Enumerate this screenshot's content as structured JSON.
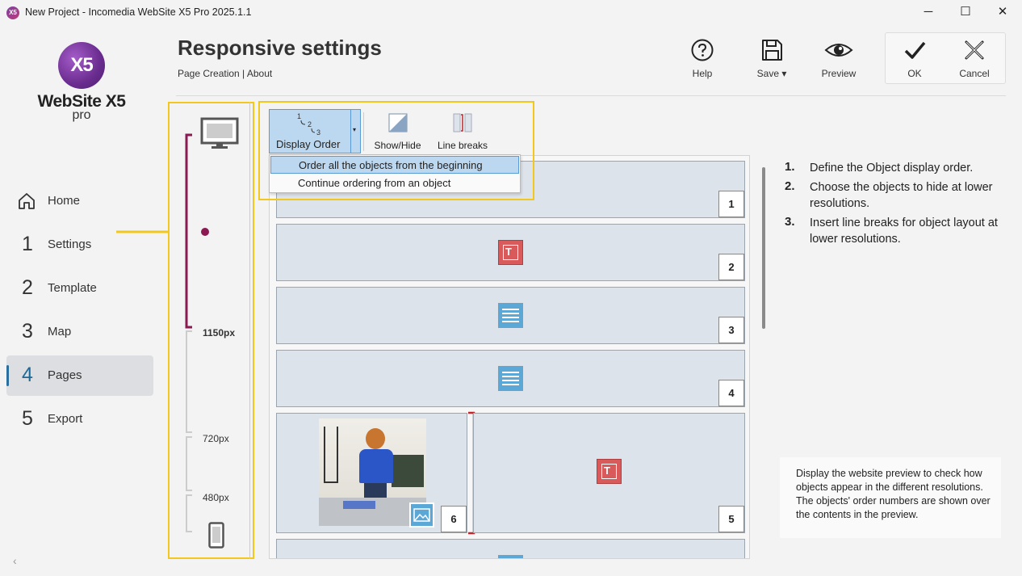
{
  "window": {
    "title": "New Project - Incomedia WebSite X5 Pro 2025.1.1",
    "app_icon": "X5",
    "minimize": "─",
    "maximize": "☐",
    "close": "✕"
  },
  "logo": {
    "mark": "X5",
    "name": "WebSite X5",
    "edition": "pro"
  },
  "nav": [
    {
      "num": "",
      "label": "Home",
      "icon": "home-icon"
    },
    {
      "num": "1",
      "label": "Settings"
    },
    {
      "num": "2",
      "label": "Template"
    },
    {
      "num": "3",
      "label": "Map"
    },
    {
      "num": "4",
      "label": "Pages"
    },
    {
      "num": "5",
      "label": "Export"
    }
  ],
  "header": {
    "title": "Responsive settings",
    "breadcrumb": "Page Creation | About"
  },
  "toolbar": {
    "help": "Help",
    "save": "Save ▾",
    "preview": "Preview",
    "ok": "OK",
    "cancel": "Cancel"
  },
  "resolutions": {
    "r1": "1150px",
    "r2": "720px",
    "r3": "480px"
  },
  "tools": {
    "display_order": "Display Order",
    "order_digits": [
      "1",
      "2",
      "3"
    ],
    "show_hide": "Show/Hide",
    "line_breaks": "Line breaks",
    "menu": [
      "Order all the objects from the beginning",
      "Continue ordering from an object"
    ]
  },
  "grid": {
    "badges": [
      "1",
      "2",
      "3",
      "4",
      "5",
      "6"
    ],
    "title_glyph": "T"
  },
  "help": {
    "steps": [
      {
        "num": "1.",
        "text": "Define the Object display order."
      },
      {
        "num": "2.",
        "text": "Choose the objects to hide at lower resolutions."
      },
      {
        "num": "3.",
        "text": "Insert line breaks for object layout at lower resolutions."
      }
    ],
    "note": "Display the website preview to check how objects appear in the different resolutions. The objects' order numbers are shown over the contents in the preview."
  },
  "colors": {
    "accent": "#2a6f9e",
    "highlight": "#f2c81e",
    "breakpoint": "#8b1a52",
    "text_icon": "#5ba7d6",
    "title_icon": "#d95a5a"
  }
}
